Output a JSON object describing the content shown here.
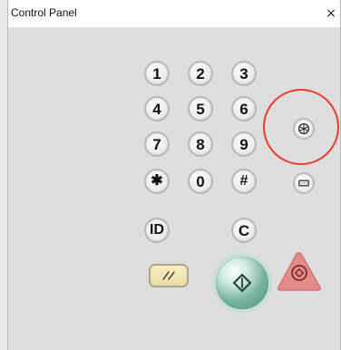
{
  "window": {
    "title": "Control Panel",
    "close_glyph": "×"
  },
  "keypad": {
    "keys": [
      {
        "label": "1"
      },
      {
        "label": "2"
      },
      {
        "label": "3"
      },
      {
        "label": "4"
      },
      {
        "label": "5"
      },
      {
        "label": "6"
      },
      {
        "label": "7"
      },
      {
        "label": "8"
      },
      {
        "label": "9"
      },
      {
        "label": "✱"
      },
      {
        "label": "0"
      },
      {
        "label": "#"
      }
    ],
    "id_key": "ID",
    "clear_key": "C"
  },
  "colors": {
    "highlight": "#e43d2e",
    "start_button": "#78b59f",
    "stop_button": "#e38b8b",
    "reset_button": "#eadca4"
  },
  "icons": {
    "energy_saver": "settings-icon",
    "counter_check": "counter-icon",
    "reset": "reset-icon",
    "start": "start-icon",
    "stop": "stop-icon"
  }
}
